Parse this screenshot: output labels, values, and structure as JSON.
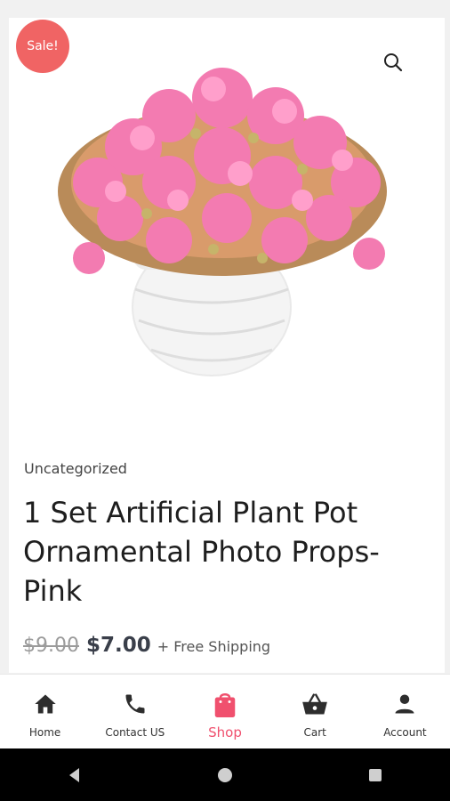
{
  "badge": {
    "label": "Sale!"
  },
  "product": {
    "category": "Uncategorized",
    "title": "1 Set Artificial Plant Pot Ornamental Photo Props-Pink",
    "old_price": "$9.00",
    "new_price": "$7.00",
    "shipping_note": "+ Free Shipping"
  },
  "nav": {
    "items": [
      {
        "label": "Home",
        "icon": "home-icon"
      },
      {
        "label": "Contact US",
        "icon": "phone-icon"
      },
      {
        "label": "Shop",
        "icon": "shopping-bag-icon",
        "active": true
      },
      {
        "label": "Cart",
        "icon": "basket-icon"
      },
      {
        "label": "Account",
        "icon": "user-icon"
      }
    ]
  },
  "colors": {
    "sale_badge": "#f06464",
    "accent": "#f0506e",
    "price": "#3a3f4a"
  },
  "system_nav": [
    "back-icon",
    "home-circle-icon",
    "recents-icon"
  ]
}
